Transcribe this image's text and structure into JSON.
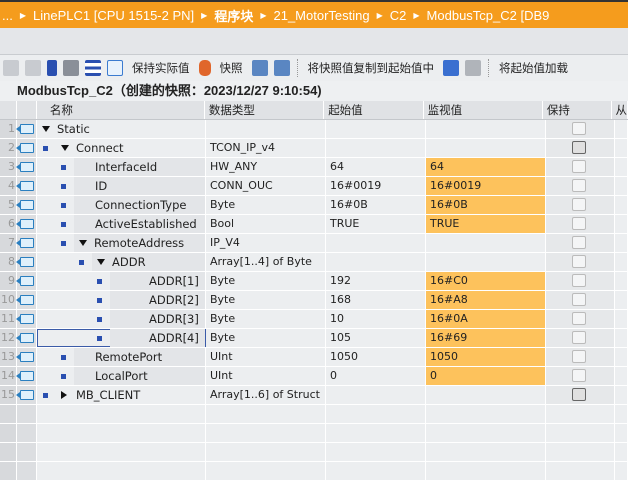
{
  "breadcrumb": {
    "items": [
      "...",
      "LinePLC1 [CPU 1515-2 PN]",
      "程序块",
      "21_MotorTesting",
      "C2",
      "ModbusTcp_C2 [DB9"
    ]
  },
  "toolbar": {
    "keep_actual": "保持实际值",
    "snapshot": "快照",
    "copy_snapshot": "将快照值复制到起始值中",
    "load_start": "将起始值加载"
  },
  "title": "ModbusTcp_C2（创建的快照：2023/12/27 9:10:54)",
  "columns": {
    "name": "名称",
    "type": "数据类型",
    "start": "起始值",
    "monitor": "监视值",
    "retain": "保持",
    "last": "从"
  },
  "accent": {
    "breadcrumb": "#f59c1d",
    "monitor": "#fdc25c"
  },
  "rows": [
    {
      "num": "1",
      "level": 0,
      "expand": "down",
      "dot": false,
      "name": "Static",
      "type": "",
      "start": "",
      "monitor": "",
      "retain_dark": false
    },
    {
      "num": "2",
      "level": 1,
      "expand": "down",
      "dot": true,
      "name": "Connect",
      "type": "TCON_IP_v4",
      "start": "",
      "monitor": "",
      "retain_dark": true
    },
    {
      "num": "3",
      "level": 2,
      "expand": "",
      "dot": true,
      "name": "InterfaceId",
      "type": "HW_ANY",
      "start": "64",
      "monitor": "64",
      "retain_dark": false
    },
    {
      "num": "4",
      "level": 2,
      "expand": "",
      "dot": true,
      "name": "ID",
      "type": "CONN_OUC",
      "start": "16#0019",
      "monitor": "16#0019",
      "retain_dark": false
    },
    {
      "num": "5",
      "level": 2,
      "expand": "",
      "dot": true,
      "name": "ConnectionType",
      "type": "Byte",
      "start": "16#0B",
      "monitor": "16#0B",
      "retain_dark": false
    },
    {
      "num": "6",
      "level": 2,
      "expand": "",
      "dot": true,
      "name": "ActiveEstablished",
      "type": "Bool",
      "start": "TRUE",
      "monitor": "TRUE",
      "retain_dark": false
    },
    {
      "num": "7",
      "level": 2,
      "expand": "down",
      "dot": true,
      "name": "RemoteAddress",
      "type": "IP_V4",
      "start": "",
      "monitor": "",
      "retain_dark": false
    },
    {
      "num": "8",
      "level": 3,
      "expand": "down",
      "dot": true,
      "name": "ADDR",
      "type": "Array[1..4] of Byte",
      "start": "",
      "monitor": "",
      "retain_dark": false
    },
    {
      "num": "9",
      "level": 4,
      "expand": "",
      "dot": true,
      "name": "ADDR[1]",
      "type": "Byte",
      "start": "192",
      "monitor": "16#C0",
      "retain_dark": false
    },
    {
      "num": "10",
      "level": 4,
      "expand": "",
      "dot": true,
      "name": "ADDR[2]",
      "type": "Byte",
      "start": "168",
      "monitor": "16#A8",
      "retain_dark": false
    },
    {
      "num": "11",
      "level": 4,
      "expand": "",
      "dot": true,
      "name": "ADDR[3]",
      "type": "Byte",
      "start": "10",
      "monitor": "16#0A",
      "retain_dark": false
    },
    {
      "num": "12",
      "level": 4,
      "expand": "",
      "dot": true,
      "name": "ADDR[4]",
      "type": "Byte",
      "start": "105",
      "monitor": "16#69",
      "retain_dark": false,
      "selected": true
    },
    {
      "num": "13",
      "level": 2,
      "expand": "",
      "dot": true,
      "name": "RemotePort",
      "type": "UInt",
      "start": "1050",
      "monitor": "1050",
      "retain_dark": false
    },
    {
      "num": "14",
      "level": 2,
      "expand": "",
      "dot": true,
      "name": "LocalPort",
      "type": "UInt",
      "start": "0",
      "monitor": "0",
      "retain_dark": false
    },
    {
      "num": "15",
      "level": 1,
      "expand": "right",
      "dot": true,
      "name": "MB_CLIENT",
      "type": "Array[1..6] of Struct",
      "start": "",
      "monitor": "",
      "retain_dark": true
    }
  ]
}
